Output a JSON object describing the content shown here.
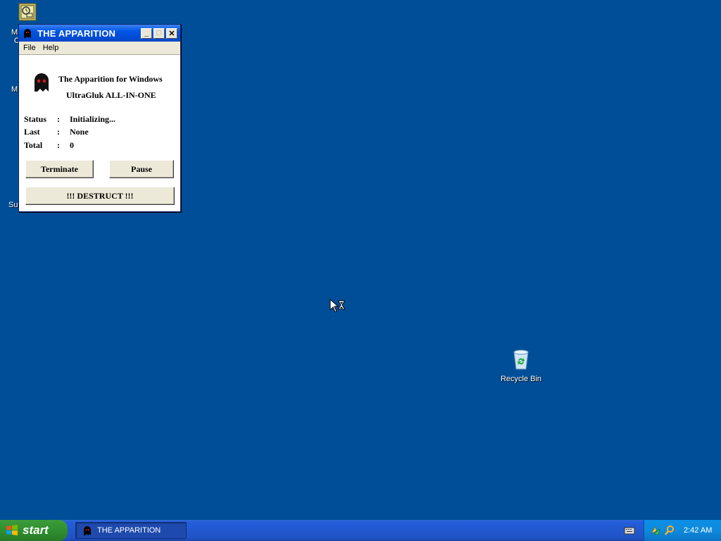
{
  "window": {
    "title": "THE APPARITION",
    "menu": [
      "File",
      "Help"
    ],
    "heading_line1": "The Apparition for Windows",
    "heading_line2": "UltraGluk   ALL-IN-ONE",
    "rows": [
      {
        "key": "Status",
        "sep": ":",
        "value": "Initializing..."
      },
      {
        "key": "Last",
        "sep": ":",
        "value": "None"
      },
      {
        "key": "Total",
        "sep": ":",
        "value": "0"
      }
    ],
    "buttons": {
      "terminate": "Terminate",
      "pause": "Pause",
      "destruct": "!!! DESTRUCT !!!"
    }
  },
  "desktop": {
    "recycle_bin_label": "Recycle Bin",
    "partial_icon_labels": [
      "Mi",
      "C",
      "M",
      "Sup"
    ]
  },
  "taskbar": {
    "start_label": "start",
    "task_item": "THE APPARITION",
    "clock": "2:42 AM"
  },
  "icons": {
    "app": "ghost-icon",
    "recycle": "recycle-bin-icon",
    "windows_flag": "windows-flag-icon"
  }
}
